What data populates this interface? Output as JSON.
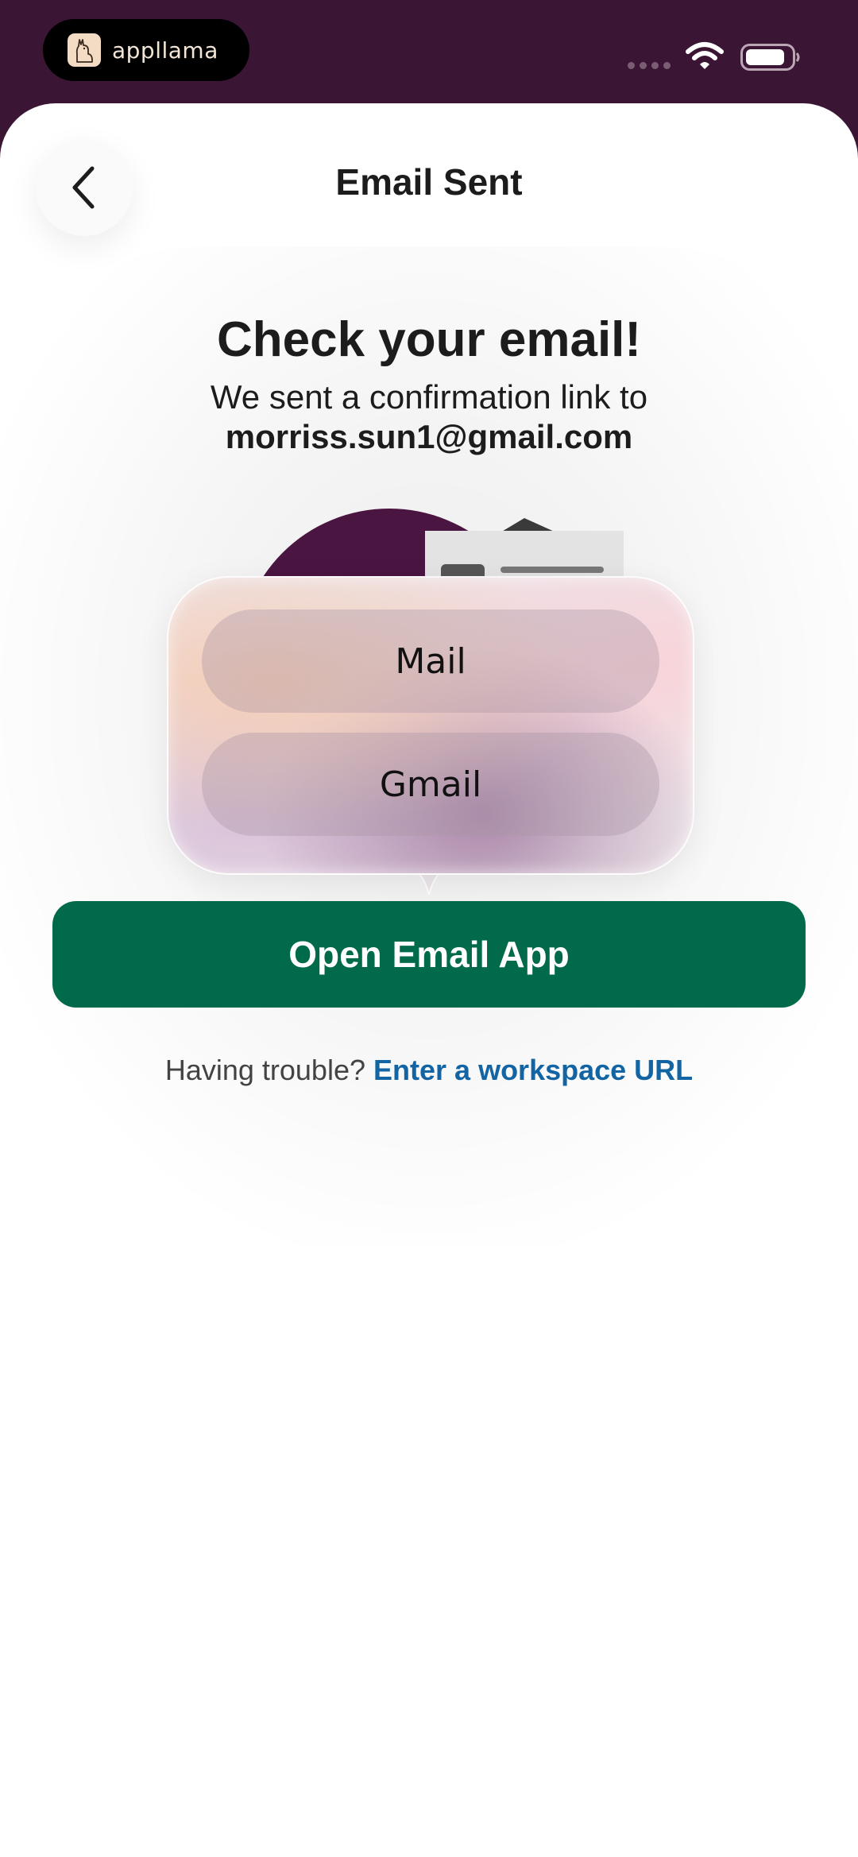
{
  "status_bar": {
    "brand": "appllama"
  },
  "header": {
    "title": "Email Sent",
    "back_icon": "chevron-left-icon"
  },
  "content": {
    "headline": "Check your email!",
    "subline": "We sent a confirmation link to",
    "email": "morriss.sun1@gmail.com"
  },
  "email_app_menu": {
    "items": [
      {
        "label": "Mail"
      },
      {
        "label": "Gmail"
      }
    ]
  },
  "primary_button": {
    "label": "Open Email App",
    "color": "#016a4a"
  },
  "footer": {
    "trouble_text": "Having trouble?",
    "link_text": "Enter a workspace URL",
    "link_color": "#1264a3"
  },
  "colors": {
    "status_bar_bg": "#3a1534",
    "illustration_purple": "#4a1541"
  }
}
